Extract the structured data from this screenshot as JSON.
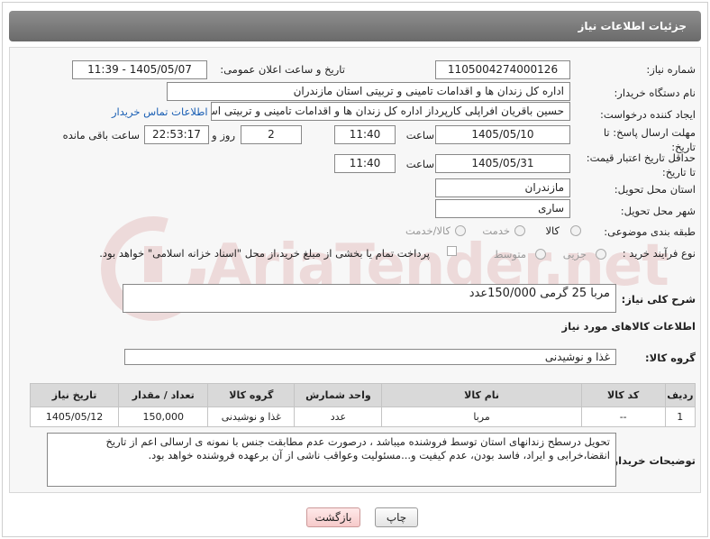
{
  "page": {
    "title": "جزئیات اطلاعات نیاز"
  },
  "form": {
    "need_number_label": "شماره نیاز:",
    "need_number": "1105004274000126",
    "announce_label": "تاریخ و ساعت اعلان عمومی:",
    "announce_value": "1405/05/07 - 11:39",
    "buyer_org_label": "نام دستگاه خریدار:",
    "buyer_org": "اداره کل زندان ها و اقدامات تامینی و تربیتی استان مازندران",
    "creator_label": "ایجاد کننده درخواست:",
    "creator": "حسین باقریان افراپلی کارپرداز اداره کل زندان ها و اقدامات تامینی و تربیتی استان",
    "contact_link": "اطلاعات تماس خریدار",
    "deadline_label": "مهلت ارسال پاسخ: تا تاریخ:",
    "deadline_date": "1405/05/10",
    "time_label": "ساعت",
    "deadline_time": "11:40",
    "days_value": "2",
    "days_label": "روز و",
    "remaining_value": "22:53:17",
    "remaining_label": "ساعت باقی مانده",
    "price_validity_label": "حداقل تاریخ اعتبار قیمت: تا تاریخ:",
    "price_validity_date": "1405/05/31",
    "price_validity_time": "11:40",
    "province_label": "استان محل تحویل:",
    "province": "مازندران",
    "city_label": "شهر محل تحویل:",
    "city": "ساری",
    "category_label": "طبقه بندی موضوعی:",
    "category_options": [
      "کالا",
      "خدمت",
      "کالا/خدمت"
    ],
    "process_label": "نوع فرآیند خرید :",
    "process_options": [
      "جزیی",
      "متوسط"
    ],
    "payment_note": "پرداخت تمام یا بخشی از مبلغ خرید،از محل \"اسناد خزانه اسلامی\" خواهد بود.",
    "description_label": "شرح کلی نیاز:",
    "description": "مربا 25 گرمی 150/000عدد",
    "goods_info_title": "اطلاعات کالاهای مورد نیاز",
    "goods_group_label": "گروه کالا:",
    "goods_group": "غذا و نوشیدنی",
    "buyer_notes_label": "توضیحات خریدار:",
    "buyer_notes": "تحویل درسطح زندانهای استان توسط فروشنده میباشد ، درصورت عدم مطابقت جنس با نمونه ی ارسالی اعم از تاریخ انقضا،خرابی و ایراد، فاسد بودن، عدم کیفیت و...مسئولیت وعواقب ناشی از آن برعهده فروشنده خواهد بود."
  },
  "table": {
    "headers": [
      "ردیف",
      "کد کالا",
      "نام کالا",
      "واحد شمارش",
      "گروه کالا",
      "تعداد / مقدار",
      "تاریخ نیاز"
    ],
    "rows": [
      [
        "1",
        "--",
        "مربا",
        "عدد",
        "غذا و نوشیدنی",
        "150,000",
        "1405/05/12"
      ]
    ]
  },
  "buttons": {
    "print": "چاپ",
    "back": "بازگشت"
  },
  "watermark": "AriaTender.net",
  "colors": {
    "titlebar": "#7a7a7a",
    "link": "#1a5fb4",
    "back_button": "#f6caca",
    "watermark": "#b32020"
  }
}
